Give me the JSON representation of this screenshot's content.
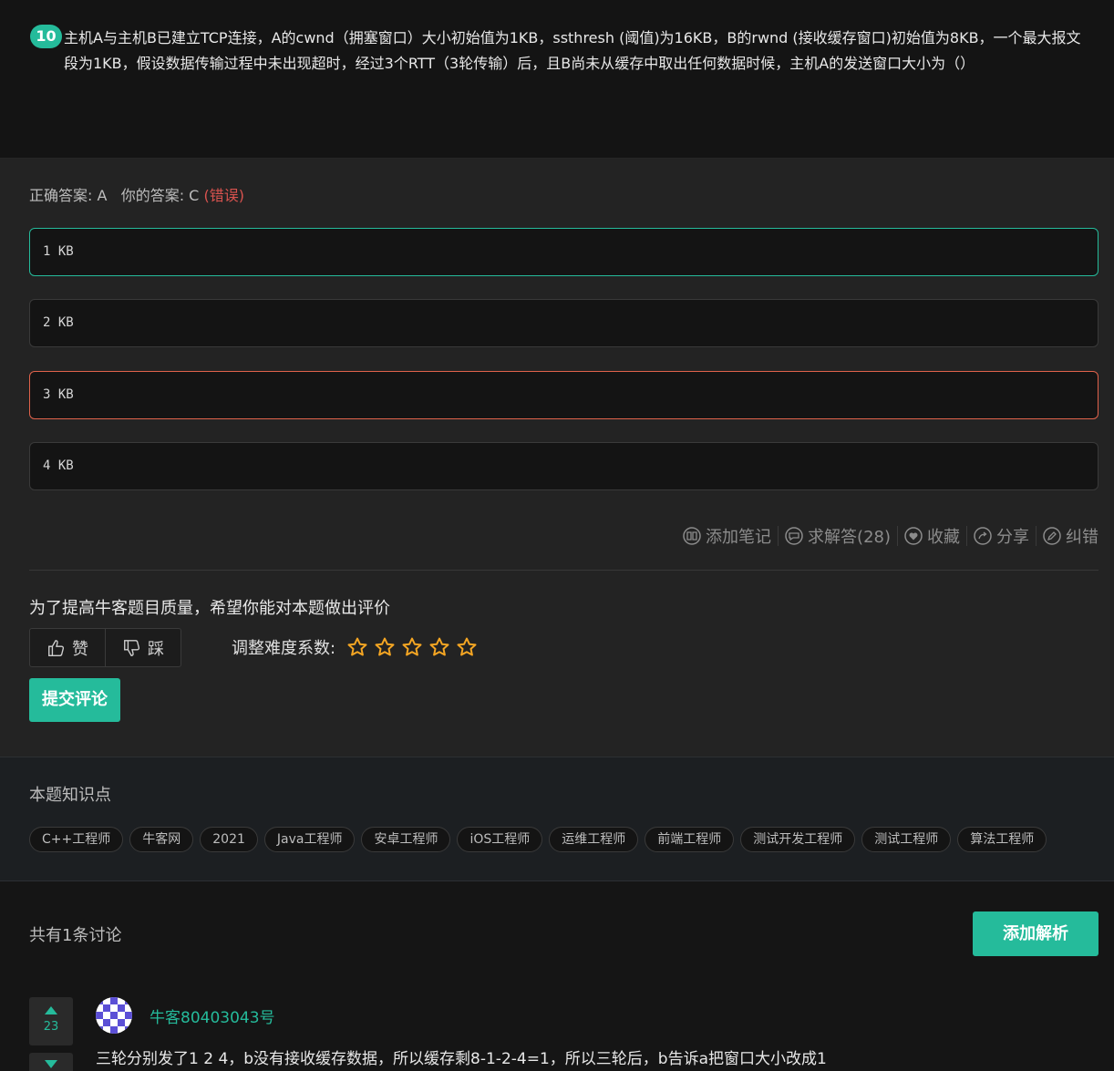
{
  "question": {
    "number": "10",
    "text": "主机A与主机B已建立TCP连接，A的cwnd（拥塞窗口）大小初始值为1KB，ssthresh (阈值)为16KB，B的rwnd (接收缓存窗口)初始值为8KB，一个最大报文段为1KB，假设数据传输过程中未出现超时，经过3个RTT（3轮传输）后，且B尚未从缓存中取出任何数据时候，主机A的发送窗口大小为（）"
  },
  "result": {
    "correct_label": "正确答案: A",
    "your_label": "你的答案: C",
    "status": "(错误)"
  },
  "options": [
    {
      "text": "1 KB",
      "state": "correct"
    },
    {
      "text": "2 KB",
      "state": "normal"
    },
    {
      "text": "3 KB",
      "state": "chosen"
    },
    {
      "text": "4 KB",
      "state": "normal"
    }
  ],
  "actions": {
    "add_note": "添加笔记",
    "ask_answer": "求解答(28)",
    "favorite": "收藏",
    "share": "分享",
    "report_error": "纠错"
  },
  "rating": {
    "prompt": "为了提高牛客题目质量，希望你能对本题做出评价",
    "like": "赞",
    "dislike": "踩",
    "difficulty_label": "调整难度系数:",
    "stars": 5,
    "submit": "提交评论"
  },
  "knowledge": {
    "title": "本题知识点",
    "tags": [
      "C++工程师",
      "牛客网",
      "2021",
      "Java工程师",
      "安卓工程师",
      "iOS工程师",
      "运维工程师",
      "前端工程师",
      "测试开发工程师",
      "测试工程师",
      "算法工程师"
    ]
  },
  "discussion": {
    "count_label": "共有1条讨论",
    "add_button": "添加解析",
    "comments": [
      {
        "user": "牛客80403043号",
        "upvotes": "23",
        "text": "三轮分别发了1 2 4，b没有接收缓存数据，所以缓存剩8-1-2-4=1，所以三轮后，b告诉a把窗口大小改成1"
      }
    ]
  },
  "colors": {
    "accent": "#25bb9b",
    "error": "#d9534f",
    "star": "#f5a623"
  }
}
